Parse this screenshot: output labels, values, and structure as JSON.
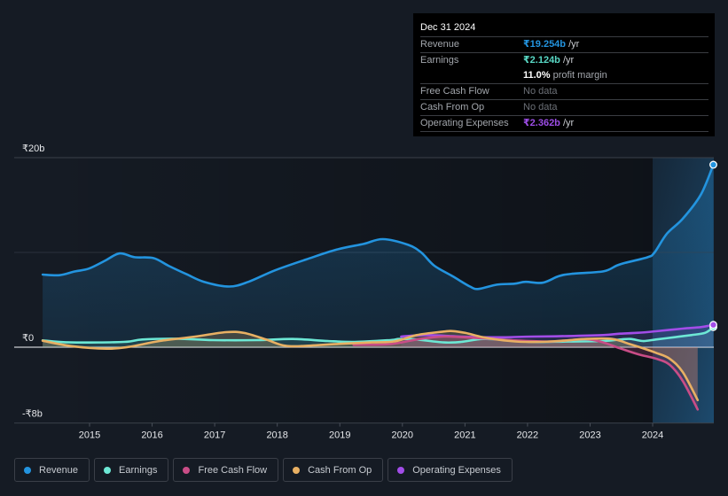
{
  "tooltip": {
    "date": "Dec 31 2024",
    "revenue": {
      "label": "Revenue",
      "value": "₹19.254b",
      "unit": " /yr",
      "color": "#2394df"
    },
    "earnings": {
      "label": "Earnings",
      "value": "₹2.124b",
      "unit": " /yr",
      "color": "#59d8c5",
      "margin_value": "11.0%",
      "margin_text": " profit margin"
    },
    "free_cash_flow": {
      "label": "Free Cash Flow",
      "value": "No data"
    },
    "cash_from_op": {
      "label": "Cash From Op",
      "value": "No data"
    },
    "operating_expenses": {
      "label": "Operating Expenses",
      "value": "₹2.362b",
      "unit": " /yr",
      "color": "#9d4de6"
    }
  },
  "legend": [
    {
      "label": "Revenue",
      "color": "#2394df"
    },
    {
      "label": "Earnings",
      "color": "#6de8d5"
    },
    {
      "label": "Free Cash Flow",
      "color": "#c94d87"
    },
    {
      "label": "Cash From Op",
      "color": "#e8b063"
    },
    {
      "label": "Operating Expenses",
      "color": "#a24de8"
    }
  ],
  "chart_data": {
    "type": "line",
    "title": "",
    "xlabel": "",
    "ylabel": "",
    "units": "₹ billions",
    "ylim": [
      -8,
      20
    ],
    "xlim": [
      2014.25,
      2025.0
    ],
    "gridlines": [
      20,
      10,
      0,
      -8
    ],
    "y_ticks": [
      {
        "value": 20,
        "label": "₹20b"
      },
      {
        "value": 0,
        "label": "₹0"
      },
      {
        "value": -8,
        "label": "-₹8b"
      }
    ],
    "x_ticks": [
      {
        "value": 2015,
        "label": "2015"
      },
      {
        "value": 2016,
        "label": "2016"
      },
      {
        "value": 2017,
        "label": "2017"
      },
      {
        "value": 2018,
        "label": "2018"
      },
      {
        "value": 2019,
        "label": "2019"
      },
      {
        "value": 2020,
        "label": "2020"
      },
      {
        "value": 2021,
        "label": "2021"
      },
      {
        "value": 2022,
        "label": "2022"
      },
      {
        "value": 2023,
        "label": "2023"
      },
      {
        "value": 2024,
        "label": "2024"
      }
    ],
    "highlight_range": [
      2024.0,
      2024.97
    ],
    "legend_position": "bottom",
    "series": [
      {
        "name": "Revenue",
        "key": "revenue",
        "color": "#2394df",
        "end_marker": true,
        "points": [
          [
            2014.25,
            7.66
          ],
          [
            2014.52,
            7.6
          ],
          [
            2014.77,
            8.0
          ],
          [
            2014.99,
            8.3
          ],
          [
            2015.24,
            9.1
          ],
          [
            2015.48,
            9.9
          ],
          [
            2015.72,
            9.5
          ],
          [
            2016.02,
            9.4
          ],
          [
            2016.26,
            8.6
          ],
          [
            2016.55,
            7.7
          ],
          [
            2016.83,
            6.9
          ],
          [
            2017.23,
            6.4
          ],
          [
            2017.54,
            6.9
          ],
          [
            2017.96,
            8.1
          ],
          [
            2018.46,
            9.25
          ],
          [
            2018.95,
            10.3
          ],
          [
            2019.38,
            10.9
          ],
          [
            2019.69,
            11.4
          ],
          [
            2020.09,
            10.8
          ],
          [
            2020.3,
            10.0
          ],
          [
            2020.51,
            8.6
          ],
          [
            2020.8,
            7.5
          ],
          [
            2021.08,
            6.4
          ],
          [
            2021.22,
            6.15
          ],
          [
            2021.51,
            6.6
          ],
          [
            2021.79,
            6.7
          ],
          [
            2021.97,
            6.9
          ],
          [
            2022.24,
            6.8
          ],
          [
            2022.5,
            7.5
          ],
          [
            2022.71,
            7.75
          ],
          [
            2023.21,
            8.0
          ],
          [
            2023.42,
            8.6
          ],
          [
            2023.56,
            8.9
          ],
          [
            2023.92,
            9.5
          ],
          [
            2024.03,
            10.0
          ],
          [
            2024.23,
            12.0
          ],
          [
            2024.48,
            13.55
          ],
          [
            2024.77,
            16.1
          ],
          [
            2024.97,
            19.254
          ]
        ]
      },
      {
        "name": "Earnings",
        "key": "earnings",
        "color": "#6de8d5",
        "end_marker": true,
        "points": [
          [
            2014.25,
            0.72
          ],
          [
            2014.7,
            0.5
          ],
          [
            2015.55,
            0.56
          ],
          [
            2015.84,
            0.81
          ],
          [
            2016.4,
            0.9
          ],
          [
            2016.97,
            0.75
          ],
          [
            2017.68,
            0.75
          ],
          [
            2018.25,
            0.87
          ],
          [
            2018.81,
            0.65
          ],
          [
            2019.24,
            0.56
          ],
          [
            2019.81,
            0.75
          ],
          [
            2019.95,
            0.87
          ],
          [
            2020.23,
            0.81
          ],
          [
            2020.66,
            0.5
          ],
          [
            2020.94,
            0.56
          ],
          [
            2021.29,
            0.87
          ],
          [
            2021.72,
            0.75
          ],
          [
            2022.07,
            0.56
          ],
          [
            2022.64,
            0.6
          ],
          [
            2023.21,
            0.65
          ],
          [
            2023.48,
            0.81
          ],
          [
            2023.65,
            0.87
          ],
          [
            2023.84,
            0.65
          ],
          [
            2024.05,
            0.81
          ],
          [
            2024.34,
            1.05
          ],
          [
            2024.62,
            1.28
          ],
          [
            2024.84,
            1.52
          ],
          [
            2024.97,
            2.124
          ]
        ]
      },
      {
        "name": "Free Cash Flow",
        "key": "fcf",
        "color": "#c94d87",
        "end_marker": false,
        "points": [
          [
            2019.22,
            0.25
          ],
          [
            2019.81,
            0.34
          ],
          [
            2020.23,
            0.81
          ],
          [
            2020.66,
            1.12
          ],
          [
            2021.22,
            0.96
          ],
          [
            2021.79,
            0.72
          ],
          [
            2022.36,
            0.6
          ],
          [
            2022.92,
            0.85
          ],
          [
            2023.21,
            0.5
          ],
          [
            2023.48,
            -0.12
          ],
          [
            2023.77,
            -0.75
          ],
          [
            2024.05,
            -1.21
          ],
          [
            2024.27,
            -1.84
          ],
          [
            2024.48,
            -3.55
          ],
          [
            2024.72,
            -6.57
          ]
        ]
      },
      {
        "name": "Cash From Op",
        "key": "cfo",
        "color": "#e8b063",
        "end_marker": false,
        "points": [
          [
            2014.25,
            0.68
          ],
          [
            2014.7,
            0.12
          ],
          [
            2015.27,
            -0.16
          ],
          [
            2015.62,
            0.03
          ],
          [
            2016.12,
            0.65
          ],
          [
            2016.69,
            1.12
          ],
          [
            2017.18,
            1.59
          ],
          [
            2017.47,
            1.5
          ],
          [
            2017.82,
            0.81
          ],
          [
            2018.1,
            0.19
          ],
          [
            2018.39,
            0.12
          ],
          [
            2018.95,
            0.34
          ],
          [
            2019.52,
            0.5
          ],
          [
            2019.88,
            0.62
          ],
          [
            2020.23,
            1.28
          ],
          [
            2020.66,
            1.65
          ],
          [
            2020.8,
            1.7
          ],
          [
            2021.01,
            1.5
          ],
          [
            2021.29,
            1.05
          ],
          [
            2021.72,
            0.65
          ],
          [
            2022.07,
            0.55
          ],
          [
            2022.5,
            0.65
          ],
          [
            2022.92,
            0.87
          ],
          [
            2023.35,
            0.87
          ],
          [
            2023.63,
            0.34
          ],
          [
            2023.92,
            -0.28
          ],
          [
            2024.05,
            -0.59
          ],
          [
            2024.27,
            -1.21
          ],
          [
            2024.48,
            -2.62
          ],
          [
            2024.72,
            -5.58
          ]
        ]
      },
      {
        "name": "Operating Expenses",
        "key": "opex",
        "color": "#a24de8",
        "end_marker": true,
        "points": [
          [
            2019.98,
            1.12
          ],
          [
            2020.37,
            1.28
          ],
          [
            2020.94,
            1.12
          ],
          [
            2021.51,
            1.05
          ],
          [
            2022.07,
            1.12
          ],
          [
            2022.64,
            1.18
          ],
          [
            2023.21,
            1.28
          ],
          [
            2023.48,
            1.43
          ],
          [
            2023.77,
            1.52
          ],
          [
            2024.05,
            1.68
          ],
          [
            2024.48,
            1.96
          ],
          [
            2024.77,
            2.12
          ],
          [
            2024.97,
            2.362
          ]
        ]
      }
    ]
  }
}
